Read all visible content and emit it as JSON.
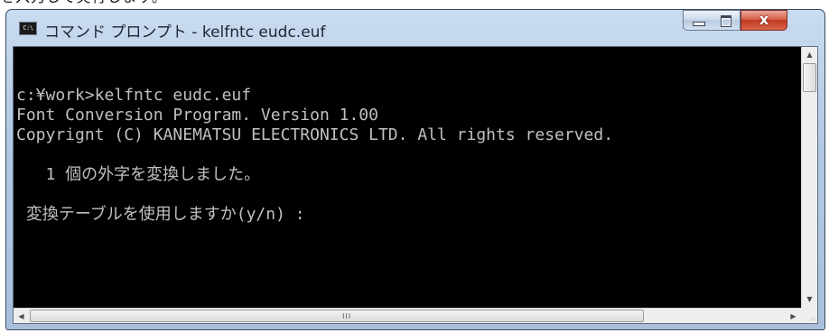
{
  "cutoff_text": "を入力して実行します。",
  "window": {
    "title": "コマンド プロンプト - kelfntc  eudc.euf",
    "icon_label": "C:\\",
    "close_glyph": "x"
  },
  "console": {
    "lines": [
      "c:¥work>kelfntc eudc.euf",
      "Font Conversion Program. Version 1.00",
      "Copyrignt (C) KANEMATSU ELECTRONICS LTD. All rights reserved.",
      "",
      "   1 個の外字を変換しました。",
      "",
      " 変換テーブルを使用しますか(y/n) :"
    ]
  },
  "scrollbars": {
    "up_arrow": "▲",
    "down_arrow": "▼",
    "left_arrow": "◀",
    "right_arrow": "▶",
    "grip": "III",
    "resize_grip": ".::"
  }
}
